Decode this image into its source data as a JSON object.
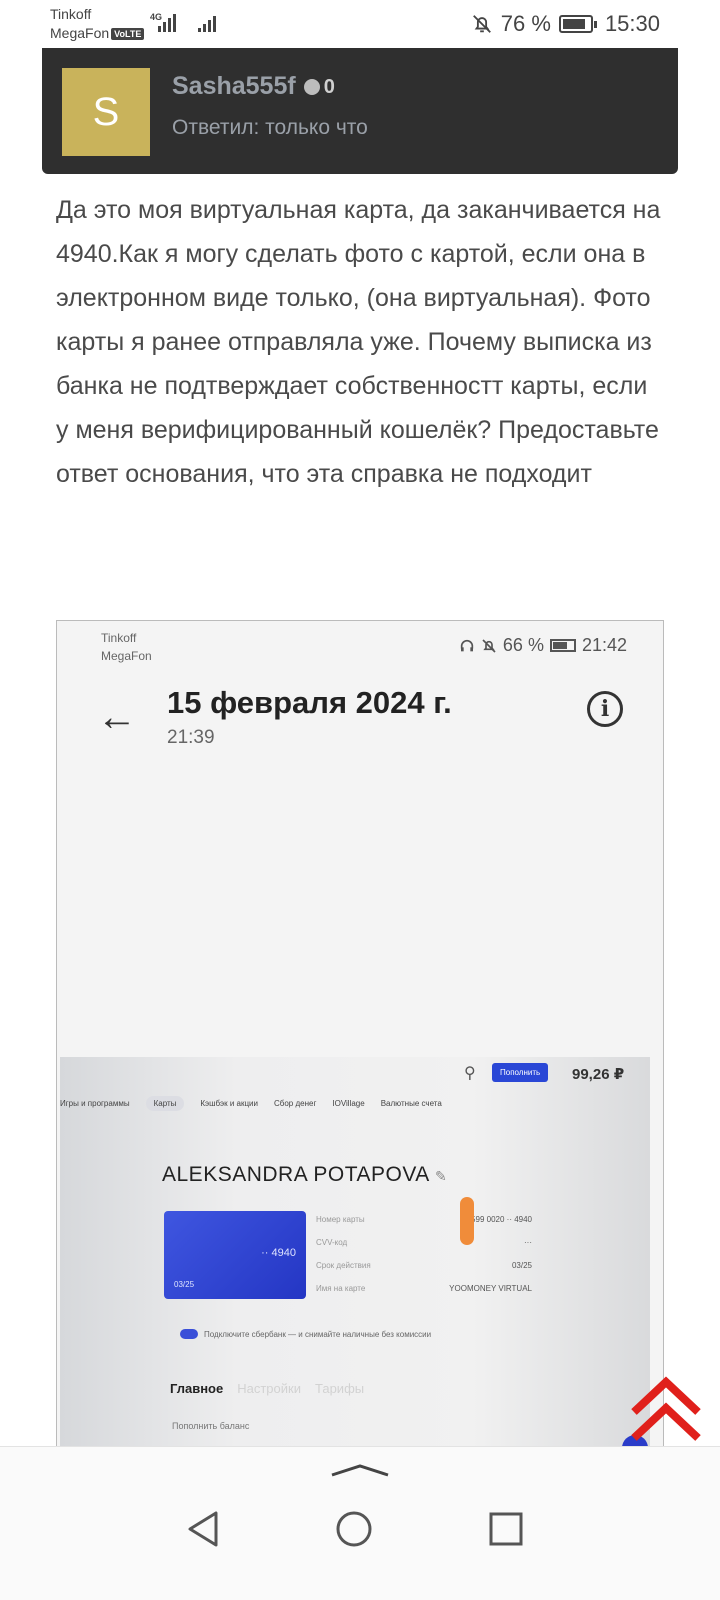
{
  "status_bar": {
    "carrier_1": "Tinkoff",
    "carrier_2": "MegaFon",
    "volte": "VoLTE",
    "network": "4G",
    "battery": "76 %",
    "time": "15:30"
  },
  "reply": {
    "avatar_letter": "S",
    "username": "Sasha555f",
    "reputation": "0",
    "answered": "Ответил: только что",
    "message": "Да это моя виртуальная карта, да заканчивается на 4940.Как я могу сделать фото с картой, если она в электронном виде только, (она виртуальная). Фото карты я ранее отправляла уже. Почему выписка из банка не подтверждает собственностт карты, если у меня верифицированный кошелёк? Предоставьте ответ основания, что эта справка не подходит"
  },
  "attachment": {
    "status_bar": {
      "carrier_1": "Tinkoff",
      "carrier_2": "MegaFon",
      "battery": "66 %",
      "time": "21:42"
    },
    "transaction": {
      "date": "15 февраля 2024 г.",
      "time": "21:39"
    },
    "bank": {
      "topup_button": "Пополнить",
      "balance": "99,26 ₽",
      "nav": [
        "Игры и программы",
        "Карты",
        "Кэшбэк и акции",
        "Сбор денег",
        "IOVillage",
        "Валютные счета"
      ],
      "active_nav": "Карты",
      "cardholder": "ALEKSANDRA POTAPOVA",
      "card_last": "·· 4940",
      "card_exp": "03/25",
      "details": [
        {
          "label": "Номер карты",
          "value": "5599 0020 ·· 4940"
        },
        {
          "label": "CVV-код",
          "value": "···"
        },
        {
          "label": "Срок действия",
          "value": "03/25"
        },
        {
          "label": "Имя на карте",
          "value": "YOOMONEY VIRTUAL"
        }
      ],
      "toggle_text": "Подключите сбербанк — и снимайте наличные без комиссии",
      "tabs": [
        "Главное",
        "Настройки",
        "Тарифы"
      ],
      "topup_row": "Пополнить баланс"
    }
  },
  "colors": {
    "card_bg": "#2f2f2f",
    "avatar": "#c9b35b",
    "scroll_top_arrow": "#e0201b",
    "bank_card": "#2a47d6"
  },
  "icons": {
    "scroll_top": "double-chevron-up-icon",
    "nav_back": "triangle-back-icon",
    "nav_home": "circle-home-icon",
    "nav_recents": "square-recents-icon"
  }
}
